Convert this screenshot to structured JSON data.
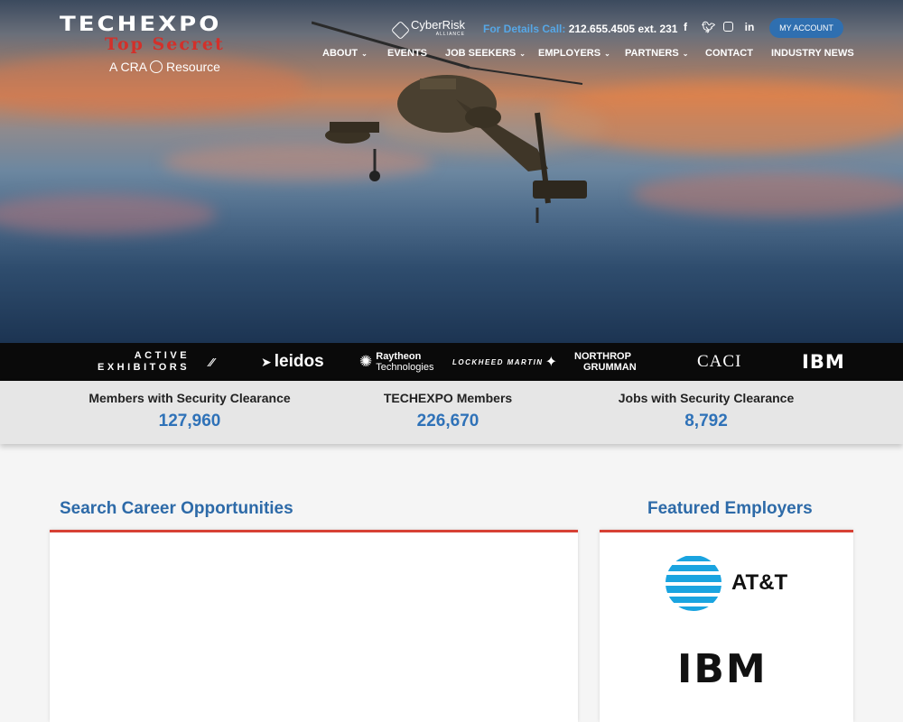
{
  "header": {
    "logo_main": "TECHEXPO",
    "logo_sub": "Top Secret",
    "logo_cra_left": "A CRA",
    "logo_cra_right": "Resource",
    "partner": "CyberRisk",
    "partner_sub": "ALLIANCE",
    "phone_label": "For Details Call:",
    "phone_number": "212.655.4505 ext. 231",
    "account_label": "MY ACCOUNT",
    "social_icons": [
      "facebook-icon",
      "twitter-icon",
      "instagram-icon",
      "linkedin-icon"
    ]
  },
  "nav": {
    "about": "ABOUT",
    "events": "EVENTS",
    "job_seekers": "JOB SEEKERS",
    "employers": "EMPLOYERS",
    "partners": "PARTNERS",
    "contact": "CONTACT",
    "industry_news": "INDUSTRY NEWS"
  },
  "exhibitors": {
    "label_line1": "ACTIVE",
    "label_line2": "EXHIBITORS",
    "logos": {
      "leidos": "leidos",
      "raytheon_1": "Raytheon",
      "raytheon_2": "Technologies",
      "lockheed": "LOCKHEED MARTIN",
      "northrop_1": "NORTHROP",
      "northrop_2": "GRUMMAN",
      "caci": "CACI",
      "ibm": "IBM"
    }
  },
  "stats": [
    {
      "label": "Members with Security Clearance",
      "value": "127,960"
    },
    {
      "label": "TECHEXPO Members",
      "value": "226,670"
    },
    {
      "label": "Jobs with Security Clearance",
      "value": "8,792"
    }
  ],
  "sections": {
    "search_title": "Search Career Opportunities",
    "featured_title": "Featured Employers",
    "featured": [
      "AT&T",
      "IBM"
    ]
  },
  "colors": {
    "accent_blue": "#2f72b8",
    "accent_red": "#d74135",
    "button_blue": "#2f6fb0"
  }
}
